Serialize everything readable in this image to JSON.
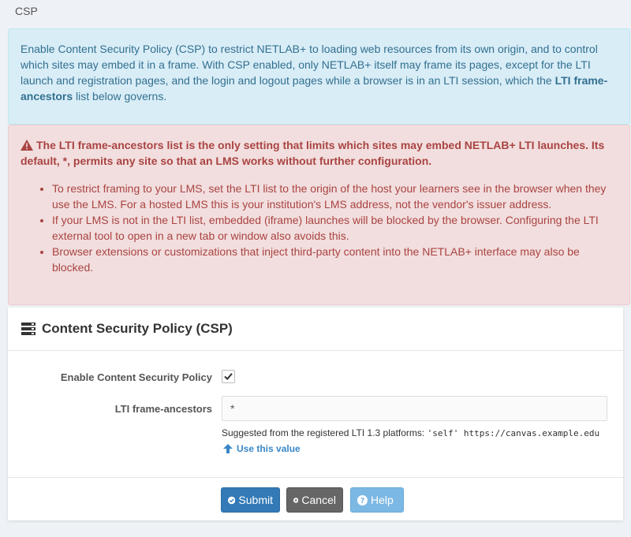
{
  "page": {
    "label": "CSP"
  },
  "info": {
    "text_prefix": "Enable Content Security Policy (CSP) to restrict NETLAB+ to loading web resources from its own origin, and to control which sites may embed it in a frame. With CSP enabled, only NETLAB+ itself may frame its pages, except for the LTI launch and registration pages, and the login and logout pages while a browser is in an LTI session, which the ",
    "text_bold": "LTI frame-ancestors",
    "text_suffix": " list below governs."
  },
  "warning": {
    "lead": "The LTI frame-ancestors list is the only setting that limits which sites may embed NETLAB+ LTI launches. Its default, *, permits any site so that an LMS works without further configuration.",
    "items": [
      "To restrict framing to your LMS, set the LTI list to the origin of the host your learners see in the browser when they use the LMS. For a hosted LMS this is your institution's LMS address, not the vendor's issuer address.",
      "If your LMS is not in the LTI list, embedded (iframe) launches will be blocked by the browser. Configuring the LTI external tool to open in a new tab or window also avoids this.",
      "Browser extensions or customizations that inject third-party content into the NETLAB+ interface may also be blocked."
    ]
  },
  "panel": {
    "title": "Content Security Policy (CSP)",
    "enable_label": "Enable Content Security Policy",
    "enable_checked": true,
    "ancestors_label": "LTI frame-ancestors",
    "ancestors_value": "*",
    "suggest_prefix": "Suggested from the registered LTI 1.3 platforms: ",
    "suggest_value": "'self' https://canvas.example.edu",
    "use_value_label": "Use this value"
  },
  "buttons": {
    "submit": "Submit",
    "cancel": "Cancel",
    "help": "Help"
  },
  "colors": {
    "primary": "#337ab7",
    "info_bg": "#d9edf7",
    "danger_bg": "#f2dede",
    "danger_text": "#a94442"
  }
}
